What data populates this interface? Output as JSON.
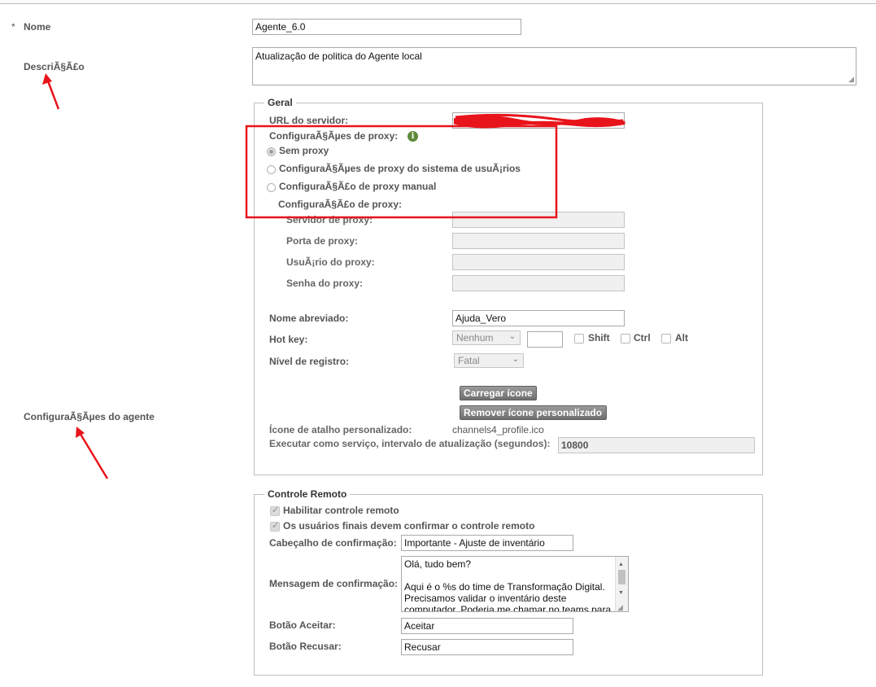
{
  "general": {
    "required_mark": "*",
    "name_label": "Nome",
    "name_value": "Agente_6.0",
    "desc_label": "DescriÃ§Ã£o",
    "desc_value": "Atualização de politica do Agente local",
    "agent_settings_label": "ConfiguraÃ§Ãµes do agente"
  },
  "geral": {
    "legend": "Geral",
    "server_url_label": "URL do servidor:",
    "proxy_settings_label": "ConfiguraÃ§Ãµes de proxy:",
    "radio_options": [
      "Sem proxy",
      "ConfiguraÃ§Ãµes de proxy do sistema de usuÃ¡rios",
      "ConfiguraÃ§Ã£o de proxy manual"
    ],
    "manual_proxy_label": "ConfiguraÃ§Ã£o de proxy:",
    "proxy_server_label": "Servidor de proxy:",
    "proxy_port_label": "Porta de proxy:",
    "proxy_user_label": "UsuÃ¡rio do proxy:",
    "proxy_pass_label": "Senha do proxy:",
    "short_name_label": "Nome abreviado:",
    "short_name_value": "Ajuda_Vero",
    "hotkey_label": "Hot key:",
    "hotkey_select": "Nenhum",
    "shift_label": "Shift",
    "ctrl_label": "Ctrl",
    "alt_label": "Alt",
    "log_level_label": "Nível de registro:",
    "log_level_select": "Fatal",
    "load_icon_button": "Carregar ícone",
    "remove_icon_button": "Remover ícone personalizado",
    "custom_icon_label": "Ícone de atalho personalizado:",
    "custom_icon_value": "channels4_profile.ico",
    "service_interval_label": "Executar como serviço, intervalo de atualização (segundos):",
    "service_interval_value": "10800"
  },
  "remote": {
    "legend": "Controle Remoto",
    "enable_label": "Habilitar controle remoto",
    "confirm_label": "Os usuários finais devem confirmar o controle remoto",
    "header_label": "Cabeçalho de confirmação:",
    "header_value": "Importante - Ajuste de inventário",
    "message_label": "Mensagem de confirmação:",
    "message_lines": [
      "Olá, tudo bem?",
      "",
      "Aqui é o %s do time de Transformação Digital.",
      "Precisamos validar o inventário deste",
      "computador. Poderia me chamar no teams para"
    ],
    "accept_label": "Botão Aceitar:",
    "accept_value": "Aceitar",
    "reject_label": "Botão Recusar:",
    "reject_value": "Recusar"
  },
  "annotation_color": "#e8141b",
  "info_icon": "info-icon"
}
